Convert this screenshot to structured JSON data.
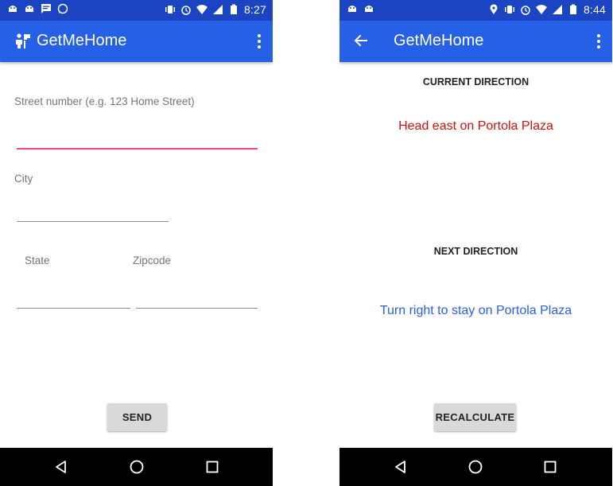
{
  "colors": {
    "status_bar": "#1a44c2",
    "app_bar": "#2660e6",
    "accent_underline": "#ff4081",
    "current_direction_text": "#d01010",
    "next_direction_text": "#2660e6"
  },
  "screen1": {
    "status_bar": {
      "left_icons": [
        "android-icon",
        "android-icon",
        "message-icon",
        "whatsapp-icon"
      ],
      "right_icons": [
        "vibrate-icon",
        "alarm-icon",
        "wifi-icon",
        "signal-icon",
        "battery-icon"
      ],
      "time": "8:27"
    },
    "app_bar": {
      "title": "GetMeHome",
      "logo": "home-user-icon",
      "menu": "more-vert-icon"
    },
    "form": {
      "street_label": "Street number (e.g. 123 Home Street)",
      "street_value": "",
      "city_label": "City",
      "city_value": "",
      "state_label": "State",
      "state_value": "",
      "zipcode_label": "Zipcode",
      "zipcode_value": ""
    },
    "send_button": "SEND",
    "nav": [
      "back-icon",
      "home-icon",
      "recents-icon"
    ]
  },
  "screen2": {
    "status_bar": {
      "left_icons": [
        "android-icon",
        "android-icon"
      ],
      "right_icons": [
        "location-icon",
        "vibrate-icon",
        "alarm-icon",
        "wifi-icon",
        "signal-icon",
        "battery-icon"
      ],
      "time": "8:44"
    },
    "app_bar": {
      "title": "GetMeHome",
      "back": "arrow-back-icon",
      "menu": "more-vert-icon"
    },
    "current_heading": "CURRENT DIRECTION",
    "current_direction": "Head east on Portola Plaza",
    "next_heading": "NEXT DIRECTION",
    "next_direction": "Turn right to stay on Portola Plaza",
    "recalculate_button": "RECALCULATE",
    "nav": [
      "back-icon",
      "home-icon",
      "recents-icon"
    ]
  }
}
